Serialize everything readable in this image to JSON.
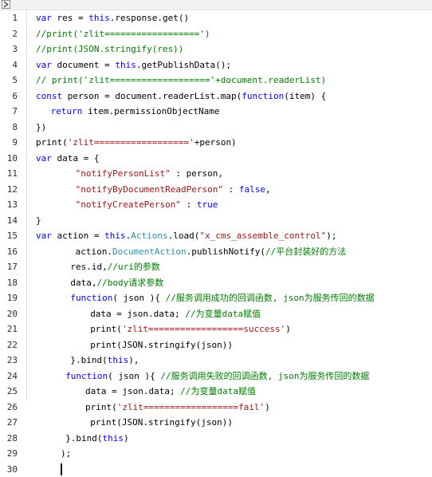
{
  "toolbar": {
    "expand_icon": "expand-arrow-icon"
  },
  "lines": [
    {
      "n": "1",
      "indent": 0,
      "tokens": [
        {
          "c": "kw",
          "t": "var "
        },
        {
          "c": "vr",
          "t": "res = "
        },
        {
          "c": "kw",
          "t": "this"
        },
        {
          "c": "vr",
          "t": ".response.get()"
        }
      ]
    },
    {
      "n": "2",
      "indent": 0,
      "tokens": [
        {
          "c": "cm",
          "t": "//print('zlit==================')"
        }
      ]
    },
    {
      "n": "3",
      "indent": 0,
      "tokens": [
        {
          "c": "cm",
          "t": "//print(JSON.stringify(res))"
        }
      ]
    },
    {
      "n": "4",
      "indent": 0,
      "tokens": [
        {
          "c": "kw",
          "t": "var "
        },
        {
          "c": "vr",
          "t": "document = "
        },
        {
          "c": "kw",
          "t": "this"
        },
        {
          "c": "vr",
          "t": ".getPublishData();"
        }
      ]
    },
    {
      "n": "5",
      "indent": 0,
      "tokens": [
        {
          "c": "cm",
          "t": "// print('zlit==================='+document.readerList)"
        }
      ]
    },
    {
      "n": "6",
      "indent": 0,
      "tokens": [
        {
          "c": "kw",
          "t": "const "
        },
        {
          "c": "vr",
          "t": "person = document.readerList.map("
        },
        {
          "c": "kw",
          "t": "function"
        },
        {
          "c": "vr",
          "t": "(item) {"
        }
      ]
    },
    {
      "n": "7",
      "indent": 3,
      "tokens": [
        {
          "c": "kw",
          "t": "return "
        },
        {
          "c": "vr",
          "t": "item.permissionObjectName"
        }
      ]
    },
    {
      "n": "8",
      "indent": 0,
      "tokens": [
        {
          "c": "vr",
          "t": "})"
        }
      ]
    },
    {
      "n": "9",
      "indent": 0,
      "tokens": [
        {
          "c": "vr",
          "t": "print("
        },
        {
          "c": "st",
          "t": "'zlit=================='"
        },
        {
          "c": "vr",
          "t": "+person)"
        }
      ]
    },
    {
      "n": "10",
      "indent": 0,
      "tokens": [
        {
          "c": "kw",
          "t": "var "
        },
        {
          "c": "vr",
          "t": "data = {"
        }
      ]
    },
    {
      "n": "11",
      "indent": 8,
      "tokens": [
        {
          "c": "st",
          "t": "\"notifyPersonList\""
        },
        {
          "c": "vr",
          "t": " : person,"
        }
      ]
    },
    {
      "n": "12",
      "indent": 8,
      "tokens": [
        {
          "c": "st",
          "t": "\"notifyByDocumentReadPerson\""
        },
        {
          "c": "vr",
          "t": " : "
        },
        {
          "c": "kw",
          "t": "false"
        },
        {
          "c": "vr",
          "t": ","
        }
      ]
    },
    {
      "n": "13",
      "indent": 8,
      "tokens": [
        {
          "c": "st",
          "t": "\"notifyCreatePerson\""
        },
        {
          "c": "vr",
          "t": " : "
        },
        {
          "c": "kw",
          "t": "true"
        }
      ]
    },
    {
      "n": "14",
      "indent": 0,
      "tokens": [
        {
          "c": "vr",
          "t": "}"
        }
      ]
    },
    {
      "n": "15",
      "indent": 0,
      "tokens": [
        {
          "c": "kw",
          "t": "var "
        },
        {
          "c": "vr",
          "t": "action = "
        },
        {
          "c": "kw",
          "t": "this"
        },
        {
          "c": "vr",
          "t": "."
        },
        {
          "c": "nm",
          "t": "Actions"
        },
        {
          "c": "vr",
          "t": ".load("
        },
        {
          "c": "st",
          "t": "\"x_cms_assemble_control\""
        },
        {
          "c": "vr",
          "t": ");"
        }
      ]
    },
    {
      "n": "16",
      "indent": 8,
      "tokens": [
        {
          "c": "vr",
          "t": "action."
        },
        {
          "c": "nm",
          "t": "DocumentAction"
        },
        {
          "c": "vr",
          "t": ".publishNotify("
        },
        {
          "c": "cm",
          "t": "//平台封装好的方法"
        }
      ]
    },
    {
      "n": "17",
      "indent": 7,
      "tokens": [
        {
          "c": "vr",
          "t": "res.id,"
        },
        {
          "c": "cm",
          "t": "//uri的参数"
        }
      ]
    },
    {
      "n": "18",
      "indent": 7,
      "tokens": [
        {
          "c": "vr",
          "t": "data,"
        },
        {
          "c": "cm",
          "t": "//body请求参数"
        }
      ]
    },
    {
      "n": "19",
      "indent": 7,
      "tokens": [
        {
          "c": "kw",
          "t": "function"
        },
        {
          "c": "vr",
          "t": "( json ){ "
        },
        {
          "c": "cm",
          "t": "//服务调用成功的回调函数, json为服务传回的数据"
        }
      ]
    },
    {
      "n": "20",
      "indent": 11,
      "tokens": [
        {
          "c": "vr",
          "t": "data = json.data; "
        },
        {
          "c": "cm",
          "t": "//为变量data赋值"
        }
      ]
    },
    {
      "n": "21",
      "indent": 11,
      "tokens": [
        {
          "c": "vr",
          "t": "print("
        },
        {
          "c": "st",
          "t": "'zlit==================success'"
        },
        {
          "c": "vr",
          "t": ")"
        }
      ]
    },
    {
      "n": "22",
      "indent": 11,
      "tokens": [
        {
          "c": "vr",
          "t": "print(JSON.stringify(json))"
        }
      ]
    },
    {
      "n": "23",
      "indent": 7,
      "tokens": [
        {
          "c": "vr",
          "t": "}.bind("
        },
        {
          "c": "kw",
          "t": "this"
        },
        {
          "c": "vr",
          "t": "),"
        }
      ]
    },
    {
      "n": "24",
      "indent": 6,
      "tokens": [
        {
          "c": "kw",
          "t": "function"
        },
        {
          "c": "vr",
          "t": "( json ){ "
        },
        {
          "c": "cm",
          "t": "//服务调用失败的回调函数, json为服务传回的数据"
        }
      ]
    },
    {
      "n": "25",
      "indent": 10,
      "tokens": [
        {
          "c": "vr",
          "t": "data = json.data; "
        },
        {
          "c": "cm",
          "t": "//为变量data赋值"
        }
      ]
    },
    {
      "n": "26",
      "indent": 10,
      "tokens": [
        {
          "c": "vr",
          "t": "print("
        },
        {
          "c": "st",
          "t": "'zlit==================fail'"
        },
        {
          "c": "vr",
          "t": ")"
        }
      ]
    },
    {
      "n": "27",
      "indent": 11,
      "tokens": [
        {
          "c": "vr",
          "t": "print(JSON.stringify(json))"
        }
      ]
    },
    {
      "n": "28",
      "indent": 6,
      "tokens": [
        {
          "c": "vr",
          "t": "}.bind("
        },
        {
          "c": "kw",
          "t": "this"
        },
        {
          "c": "vr",
          "t": ")"
        }
      ]
    },
    {
      "n": "29",
      "indent": 5,
      "tokens": [
        {
          "c": "vr",
          "t": ");"
        }
      ]
    },
    {
      "n": "30",
      "indent": 5,
      "tokens": [],
      "cursor": true
    }
  ]
}
